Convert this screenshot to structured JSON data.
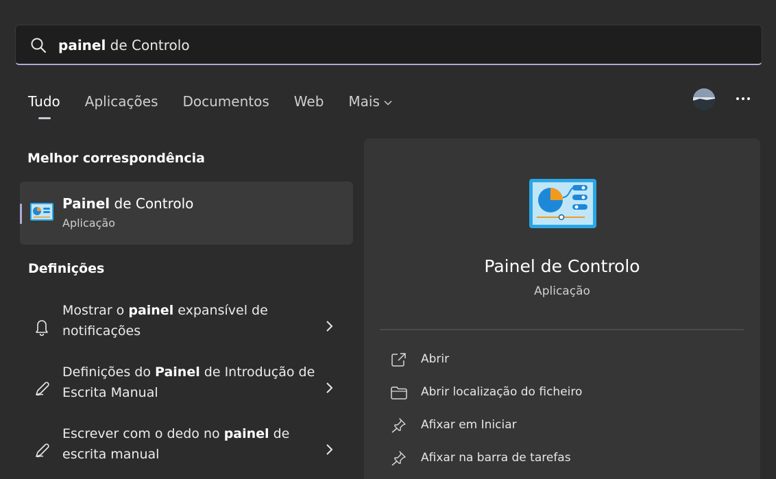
{
  "search": {
    "query_bold": "painel",
    "query_rest": " de Controlo"
  },
  "tabs": [
    {
      "label": "Tudo"
    },
    {
      "label": "Aplicações"
    },
    {
      "label": "Documentos"
    },
    {
      "label": "Web"
    },
    {
      "label": "Mais"
    }
  ],
  "sections": {
    "best_match": "Melhor correspondência",
    "settings": "Definições"
  },
  "best_match": {
    "title_bold": "Painel",
    "title_rest": " de Controlo",
    "subtitle": "Aplicação"
  },
  "settings": [
    {
      "pre": "Mostrar o ",
      "bold": "painel",
      "post": " expansível de notificações",
      "icon": "bell-icon"
    },
    {
      "pre": "Definições do ",
      "bold": "Painel",
      "post": " de Introdução de Escrita Manual",
      "icon": "pen-icon"
    },
    {
      "pre": "Escrever com o dedo no ",
      "bold": "painel",
      "post": " de escrita manual",
      "icon": "pen-icon"
    }
  ],
  "detail": {
    "title": "Painel de Controlo",
    "subtitle": "Aplicação",
    "actions": [
      {
        "label": "Abrir",
        "icon": "open-external-icon"
      },
      {
        "label": "Abrir localização do ficheiro",
        "icon": "folder-icon"
      },
      {
        "label": "Afixar em Iniciar",
        "icon": "pin-icon"
      },
      {
        "label": "Afixar na barra de tarefas",
        "icon": "pin-icon"
      }
    ]
  },
  "colors": {
    "background": "#2c2c2c",
    "accent": "#b4a8d8",
    "panel": "#363636"
  }
}
